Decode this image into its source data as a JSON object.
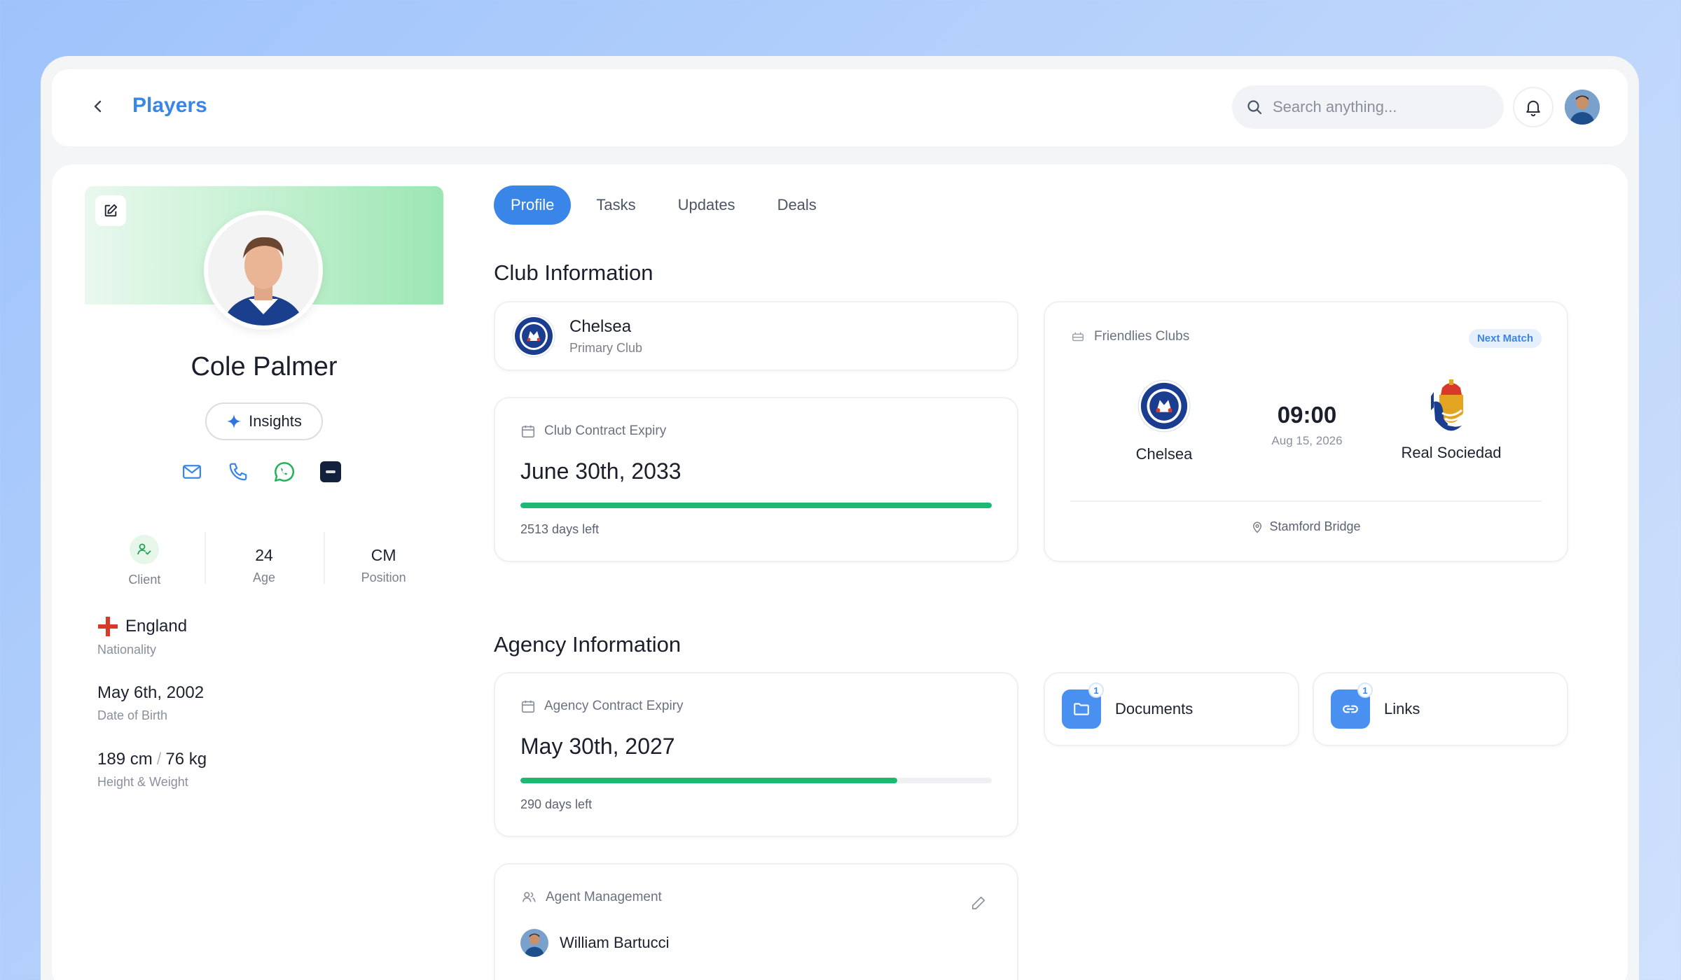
{
  "header": {
    "title": "Players",
    "search_placeholder": "Search anything..."
  },
  "player": {
    "name": "Cole Palmer",
    "insights_label": "Insights",
    "stats": [
      {
        "value": "",
        "label": "Client"
      },
      {
        "value": "24",
        "label": "Age"
      },
      {
        "value": "CM",
        "label": "Position"
      }
    ],
    "nationality": {
      "value": "England",
      "label": "Nationality"
    },
    "dob": {
      "value": "May 6th, 2002",
      "label": "Date of Birth"
    },
    "height": "189 cm",
    "separator": "/",
    "weight": "76 kg",
    "height_weight_label": "Height & Weight",
    "contact_icons": [
      "mail-icon",
      "phone-icon",
      "whatsapp-icon",
      "app-icon"
    ]
  },
  "tabs": [
    {
      "label": "Profile",
      "active": true
    },
    {
      "label": "Tasks",
      "active": false
    },
    {
      "label": "Updates",
      "active": false
    },
    {
      "label": "Deals",
      "active": false
    }
  ],
  "club_info": {
    "title": "Club Information",
    "primary_club": {
      "name": "Chelsea",
      "sub": "Primary Club"
    },
    "contract": {
      "label": "Club Contract Expiry",
      "date": "June 30th, 2033",
      "days_left": "2513 days left",
      "progress": 1.0
    },
    "friendlies": {
      "label": "Friendlies Clubs",
      "badge": "Next Match",
      "home": "Chelsea",
      "away": "Real Sociedad",
      "time": "09:00",
      "date": "Aug 15, 2026",
      "venue": "Stamford Bridge"
    }
  },
  "agency_info": {
    "title": "Agency Information",
    "contract": {
      "label": "Agency Contract Expiry",
      "date": "May 30th, 2027",
      "days_left": "290 days left",
      "progress": 0.8
    },
    "documents": {
      "label": "Documents",
      "count": "1"
    },
    "links": {
      "label": "Links",
      "count": "1"
    },
    "agent": {
      "label": "Agent Management",
      "name": "William Bartucci"
    }
  },
  "colors": {
    "accent": "#3a86e8",
    "progress": "#1db872",
    "cover_green": "#9ce6b2",
    "england_red": "#d9392b"
  }
}
